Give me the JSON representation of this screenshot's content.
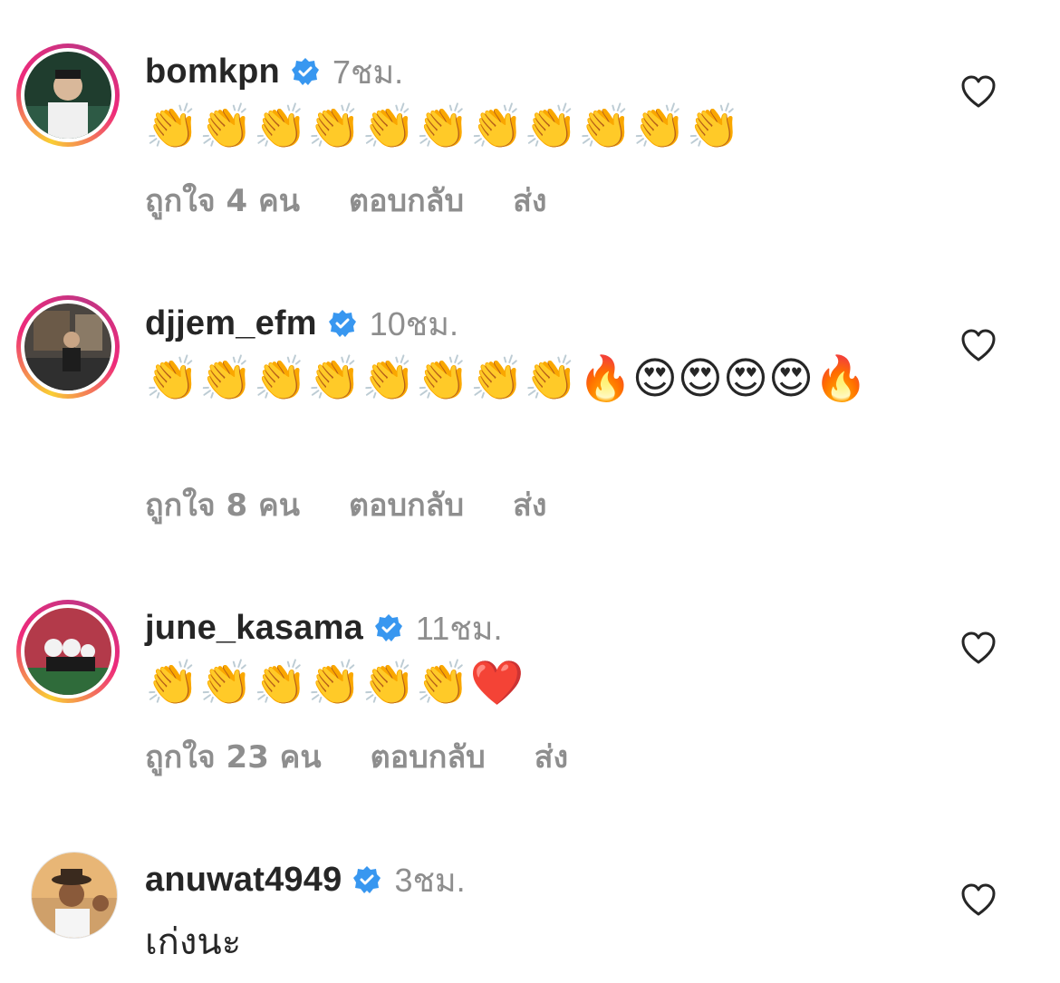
{
  "comments": [
    {
      "username": "bomkpn",
      "time": "7ชม.",
      "text": "👏👏👏👏👏👏👏👏👏👏👏",
      "likes": "ถูกใจ 4 คน",
      "reply": "ตอบกลับ",
      "send": "ส่ง"
    },
    {
      "username": "djjem_efm",
      "time": "10ชม.",
      "text": "👏👏👏👏👏👏👏👏🔥😍😍😍😍🔥",
      "likes": "ถูกใจ 8 คน",
      "reply": "ตอบกลับ",
      "send": "ส่ง"
    },
    {
      "username": "june_kasama",
      "time": "11ชม.",
      "text": "👏👏👏👏👏👏❤️",
      "likes": "ถูกใจ 23 คน",
      "reply": "ตอบกลับ",
      "send": "ส่ง"
    },
    {
      "username": "anuwat4949",
      "time": "3ชม.",
      "text": "เก่งนะ"
    }
  ],
  "colors": {
    "verified": "#3897f0",
    "muted": "#8e8e8e",
    "text": "#262626"
  },
  "icons": {
    "verified": "verified-badge-icon",
    "like": "heart-outline-icon"
  }
}
